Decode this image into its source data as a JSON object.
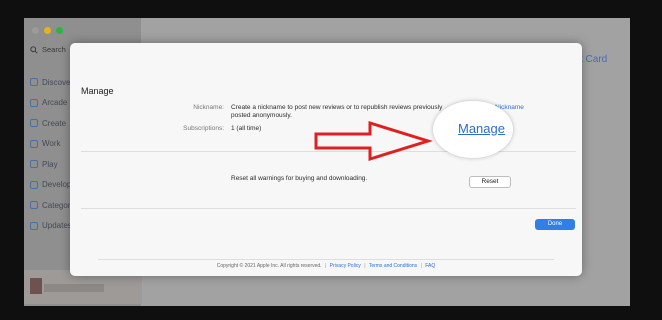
{
  "background_app": {
    "search_label": "Search",
    "sidebar_items": [
      {
        "label": "Discover",
        "icon": "star-icon"
      },
      {
        "label": "Arcade",
        "icon": "gamepad-icon"
      },
      {
        "label": "Create",
        "icon": "brush-icon"
      },
      {
        "label": "Work",
        "icon": "plane-icon"
      },
      {
        "label": "Play",
        "icon": "rocket-icon"
      },
      {
        "label": "Develop",
        "icon": "hammer-icon"
      },
      {
        "label": "Categories",
        "icon": "grid-icon"
      },
      {
        "label": "Updates",
        "icon": "download-icon"
      }
    ],
    "right_fragment": "t Card"
  },
  "sheet": {
    "title": "Manage",
    "nickname_label": "Nickname:",
    "nickname_text": "Create a nickname to post new reviews or to republish reviews previously posted anonymously.",
    "nickname_link": "Nickname",
    "subscriptions_label": "Subscriptions:",
    "subscriptions_value": "1 (all time)",
    "manage_link": "Manage",
    "reset_text": "Reset all warnings for buying and downloading.",
    "reset_button": "Reset",
    "done_button": "Done",
    "footer": {
      "copyright": "Copyright © 2021 Apple Inc. All rights reserved.",
      "privacy": "Privacy Policy",
      "terms": "Terms and Conditions",
      "faq": "FAQ",
      "separator": "|"
    }
  },
  "colors": {
    "link": "#2f6fd8",
    "done_button": "#2f7fe8",
    "arrow": "#e02020"
  }
}
